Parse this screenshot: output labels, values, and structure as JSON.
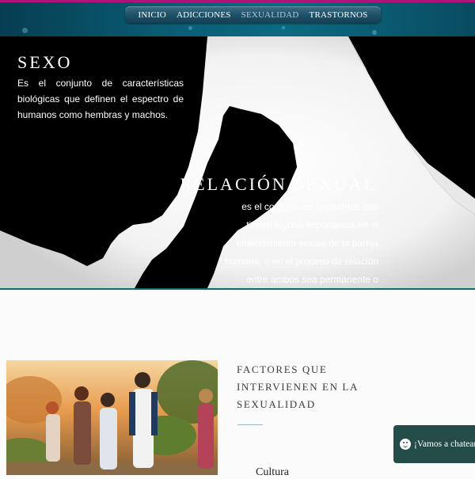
{
  "nav": {
    "items": [
      {
        "label": "INICIO"
      },
      {
        "label": "ADICCIONES"
      },
      {
        "label": "SEXUALIDAD",
        "active": true
      },
      {
        "label": "TRASTORNOS"
      }
    ]
  },
  "hero": {
    "block1": {
      "title": "SEXO",
      "text": "Es el conjunto de características biológicas que definen el espectro de humanos como hembras y machos."
    },
    "block2": {
      "title": "RELACIÓN SEXUAL",
      "text": "es el conjunto de elementos que tienen alguna importancia en el entendimiento sexual de la pareja humana, o en el proceso de relación entre ambos sea permanente o temporal."
    }
  },
  "section": {
    "title": "FACTORES QUE INTERVIENEN EN LA SEXUALIDAD",
    "first_item": "Cultura"
  },
  "chat": {
    "label": "¡Vamos a chatear!",
    "icon": "smile-icon"
  },
  "colors": {
    "topbar": "#0a5c73",
    "accent_border": "#b0127a",
    "chat_bg": "#244d4a",
    "hero_bg": "#000000"
  }
}
